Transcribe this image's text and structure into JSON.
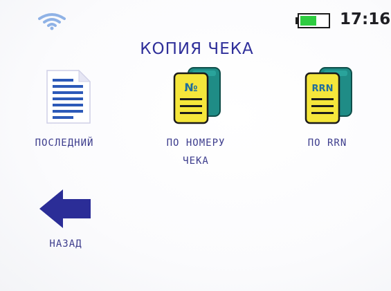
{
  "status": {
    "time": "17:16",
    "wifi_icon": "wifi-icon",
    "battery_icon": "battery-icon",
    "battery_level": 0.6,
    "battery_color": "#2ecc40"
  },
  "screen": {
    "title": "КОПИЯ ЧЕКА"
  },
  "menu": {
    "items": [
      {
        "icon": "document-icon",
        "label": "ПОСЛЕДНИЙ"
      },
      {
        "icon": "receipt-number-icon",
        "icon_text": "№",
        "label_line1": "ПО НОМЕРУ",
        "label_line2": "ЧЕКА"
      },
      {
        "icon": "receipt-rrn-icon",
        "icon_text": "RRN",
        "label": "ПО RRN"
      },
      {
        "icon": "arrow-left-icon",
        "label": "НАЗАД"
      }
    ]
  },
  "colors": {
    "title": "#2f2f9a",
    "label": "#3c3c8c",
    "arrow": "#2b2d97",
    "doc_yellow": "#f5e63b",
    "doc_teal": "#1f8c86"
  }
}
